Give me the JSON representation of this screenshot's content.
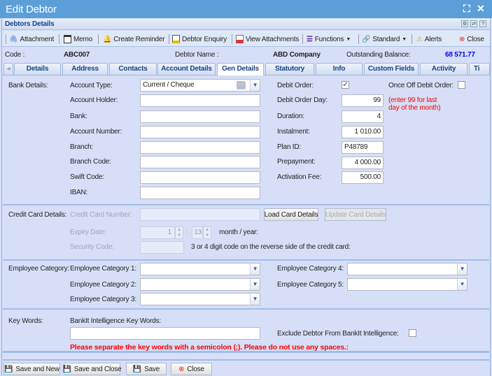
{
  "window": {
    "title": "Edit Debtor"
  },
  "panel": {
    "title": "Debtors Details"
  },
  "toolbar": {
    "attachment": "Attachment",
    "memo": "Memo",
    "create_reminder": "Create Reminder",
    "debtor_enquiry": "Debtor Enquiry",
    "view_attachments": "View Attachments",
    "functions": "Functions",
    "standard": "Standard",
    "alerts": "Alerts",
    "close": "Close"
  },
  "info": {
    "code_label": "Code :",
    "code": "ABC007",
    "name_label": "Debtor Name :",
    "name": "ABD Company",
    "balance_label": "Outstanding Balance:",
    "balance": "68 571.77",
    "balance_color": "#0000ff"
  },
  "tabs": [
    "Details",
    "Address",
    "Contacts",
    "Account Details",
    "Gen Details",
    "Statutory",
    "Info",
    "Custom Fields",
    "Activity",
    "Ti"
  ],
  "active_tab": "Gen Details",
  "bank": {
    "section": "Bank Details:",
    "account_type_label": "Account Type:",
    "account_type": "Current / Cheque",
    "account_holder_label": "Account Holder:",
    "bank_label": "Bank:",
    "account_number_label": "Account Number:",
    "branch_label": "Branch:",
    "branch_code_label": "Branch Code:",
    "swift_label": "Swift Code:",
    "iban_label": "IBAN:",
    "debit_order_label": "Debit Order:",
    "debit_order": true,
    "once_off_label": "Once Off Debit Order:",
    "once_off": false,
    "debit_order_day_label": "Debit Order Day:",
    "debit_order_day": "99",
    "note_line1": "(enter 99 for last",
    "note_line2": "day of the month)",
    "duration_label": "Duration:",
    "duration": "4",
    "instalment_label": "Instalment:",
    "instalment": "1 010.00",
    "plan_id_label": "Plan ID:",
    "plan_id": "P48789",
    "prepayment_label": "Prepayment:",
    "prepayment": "4 000.00",
    "activation_fee_label": "Activation Fee:",
    "activation_fee": "500.00"
  },
  "card": {
    "section": "Credit Card Details:",
    "number_label": "Credit Card Number:",
    "load": "Load Card Details",
    "update": "Update Card Details",
    "expiry_label": "Expiry Date:",
    "month": "1",
    "year": "13",
    "month_year": "month / year:",
    "security_label": "Security Code:",
    "security_note": "3 or 4 digit code on the reverse side of the credit card:"
  },
  "employee": {
    "section": "Employee Category:",
    "cat1": "Employee Category 1:",
    "cat2": "Employee Category 2:",
    "cat3": "Employee Category 3:",
    "cat4": "Employee Category 4:",
    "cat5": "Employee Category 5:"
  },
  "keywords": {
    "section": "Key Words:",
    "label": "BankIt Intelligence Key Words:",
    "exclude_label": "Exclude Debtor From BankIt Intelligence:",
    "exclude": false,
    "warning": "Please separate the key words with a semicolon (;). Please do not use any spaces.:"
  },
  "footer": {
    "save_new": "Save and New",
    "save_close": "Save and Close",
    "save": "Save",
    "close": "Close"
  }
}
